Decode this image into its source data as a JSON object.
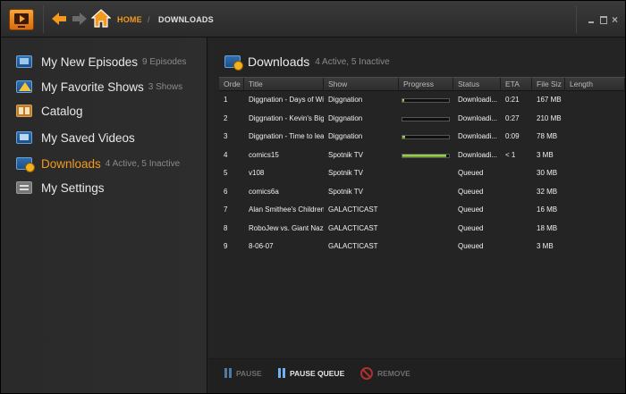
{
  "header": {
    "breadcrumb_home": "HOME",
    "breadcrumb_sep": "/",
    "breadcrumb_current": "DOWNLOADS",
    "close_glyph": "×"
  },
  "sidebar": {
    "items": [
      {
        "label": "My New Episodes",
        "count": "9 Episodes",
        "icon": "tv-icon"
      },
      {
        "label": "My Favorite Shows",
        "count": "3 Shows",
        "icon": "star-icon"
      },
      {
        "label": "Catalog",
        "count": "",
        "icon": "catalog-icon"
      },
      {
        "label": "My Saved Videos",
        "count": "",
        "icon": "saved-videos-icon"
      },
      {
        "label": "Downloads",
        "count": "4 Active, 5 Inactive",
        "icon": "downloads-icon",
        "active": true
      },
      {
        "label": "My Settings",
        "count": "",
        "icon": "settings-icon"
      }
    ]
  },
  "main": {
    "title": "Downloads",
    "subtitle": "4 Active, 5 Inactive"
  },
  "table": {
    "columns": [
      "Orde",
      "Title",
      "Show",
      "Progress",
      "Status",
      "ETA",
      "File Siz",
      "Length"
    ],
    "rows": [
      {
        "order": "1",
        "title": "Diggnation - Days of Wi",
        "show": "Diggnation",
        "progress": 0.02,
        "status": "Downloadi...",
        "eta": "0:21",
        "size": "167 MB",
        "length": ""
      },
      {
        "order": "2",
        "title": "Diggnation - Kevin's Big",
        "show": "Diggnation",
        "progress": 0.0,
        "status": "Downloadi...",
        "eta": "0:27",
        "size": "210 MB",
        "length": ""
      },
      {
        "order": "3",
        "title": "Diggnation - Time to lea",
        "show": "Diggnation",
        "progress": 0.05,
        "status": "Downloadi...",
        "eta": "0:09",
        "size": "78 MB",
        "length": ""
      },
      {
        "order": "4",
        "title": "comics15",
        "show": "Spotnik TV",
        "progress": 0.95,
        "status": "Downloadi...",
        "eta": "< 1",
        "size": "3 MB",
        "length": ""
      },
      {
        "order": "5",
        "title": "v108",
        "show": "Spotnik TV",
        "progress": null,
        "status": "Queued",
        "eta": "",
        "size": "30 MB",
        "length": ""
      },
      {
        "order": "6",
        "title": "comics6a",
        "show": "Spotnik TV",
        "progress": null,
        "status": "Queued",
        "eta": "",
        "size": "32 MB",
        "length": ""
      },
      {
        "order": "7",
        "title": "Alan Smithee's Children",
        "show": "GALACTICAST",
        "progress": null,
        "status": "Queued",
        "eta": "",
        "size": "16 MB",
        "length": ""
      },
      {
        "order": "8",
        "title": "RoboJew vs. Giant Nazi",
        "show": "GALACTICAST",
        "progress": null,
        "status": "Queued",
        "eta": "",
        "size": "18 MB",
        "length": ""
      },
      {
        "order": "9",
        "title": "8-06-07",
        "show": "GALACTICAST",
        "progress": null,
        "status": "Queued",
        "eta": "",
        "size": "3 MB",
        "length": ""
      }
    ]
  },
  "toolbar": {
    "pause_label": "PAUSE",
    "pause_queue_label": "PAUSE QUEUE",
    "remove_label": "REMOVE"
  },
  "colors": {
    "accent": "#f39a1e",
    "progress_green": "#8cc63f",
    "disabled_text": "#6e6e6e"
  }
}
